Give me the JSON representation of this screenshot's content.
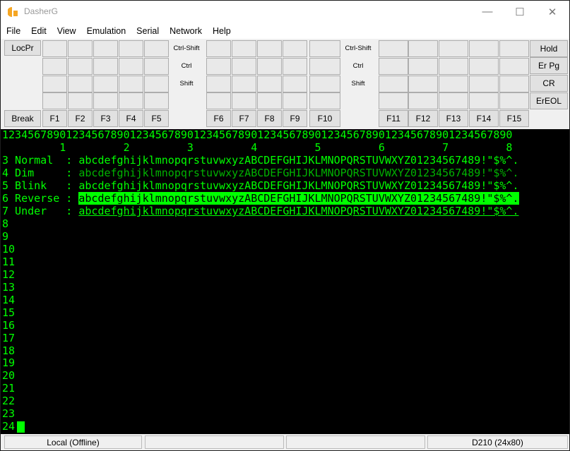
{
  "window": {
    "title": "DasherG",
    "minimize": "—",
    "maximize": "☐",
    "close": "✕"
  },
  "menu": [
    "File",
    "Edit",
    "View",
    "Emulation",
    "Serial",
    "Network",
    "Help"
  ],
  "toolbar": {
    "locpr": "LocPr",
    "break": "Break",
    "hold": "Hold",
    "erpg": "Er Pg",
    "cr": "CR",
    "ereol": "ErEOL",
    "modifiers": [
      "Ctrl-Shift",
      "Ctrl",
      "Shift"
    ],
    "fkeys": [
      "F1",
      "F2",
      "F3",
      "F4",
      "F5",
      "F6",
      "F7",
      "F8",
      "F9",
      "F10",
      "F11",
      "F12",
      "F13",
      "F14",
      "F15"
    ]
  },
  "terminal": {
    "ruler": "12345678901234567890123456789012345678901234567890123456789012345678901234567890",
    "ruler_tens": "         1         2         3         4         5         6         7         8",
    "sample_chars": "abcdefghijklmnopqrstuvwxyzABCDEFGHIJKLMNOPQRSTUVWXYZ01234567489!\"$%^.",
    "rows": [
      {
        "label": "3 Normal  : ",
        "style": "normal"
      },
      {
        "label": "4 Dim     : ",
        "style": "dim"
      },
      {
        "label": "5 Blink   : ",
        "style": "blink"
      },
      {
        "label": "6 Reverse : ",
        "style": "reverse"
      },
      {
        "label": "7 Under   : ",
        "style": "under"
      }
    ],
    "line_numbers": [
      "8",
      "9",
      "10",
      "11",
      "12",
      "13",
      "14",
      "15",
      "16",
      "17",
      "18",
      "19",
      "20",
      "21",
      "22",
      "23",
      "24"
    ]
  },
  "status": {
    "connection": "Local (Offline)",
    "panel2": "",
    "panel3": "",
    "emulation": "D210 (24x80)"
  },
  "colors": {
    "phosphor": "#00ff00",
    "dim": "#00b300",
    "background": "#000000",
    "icon": "#f5a623"
  }
}
